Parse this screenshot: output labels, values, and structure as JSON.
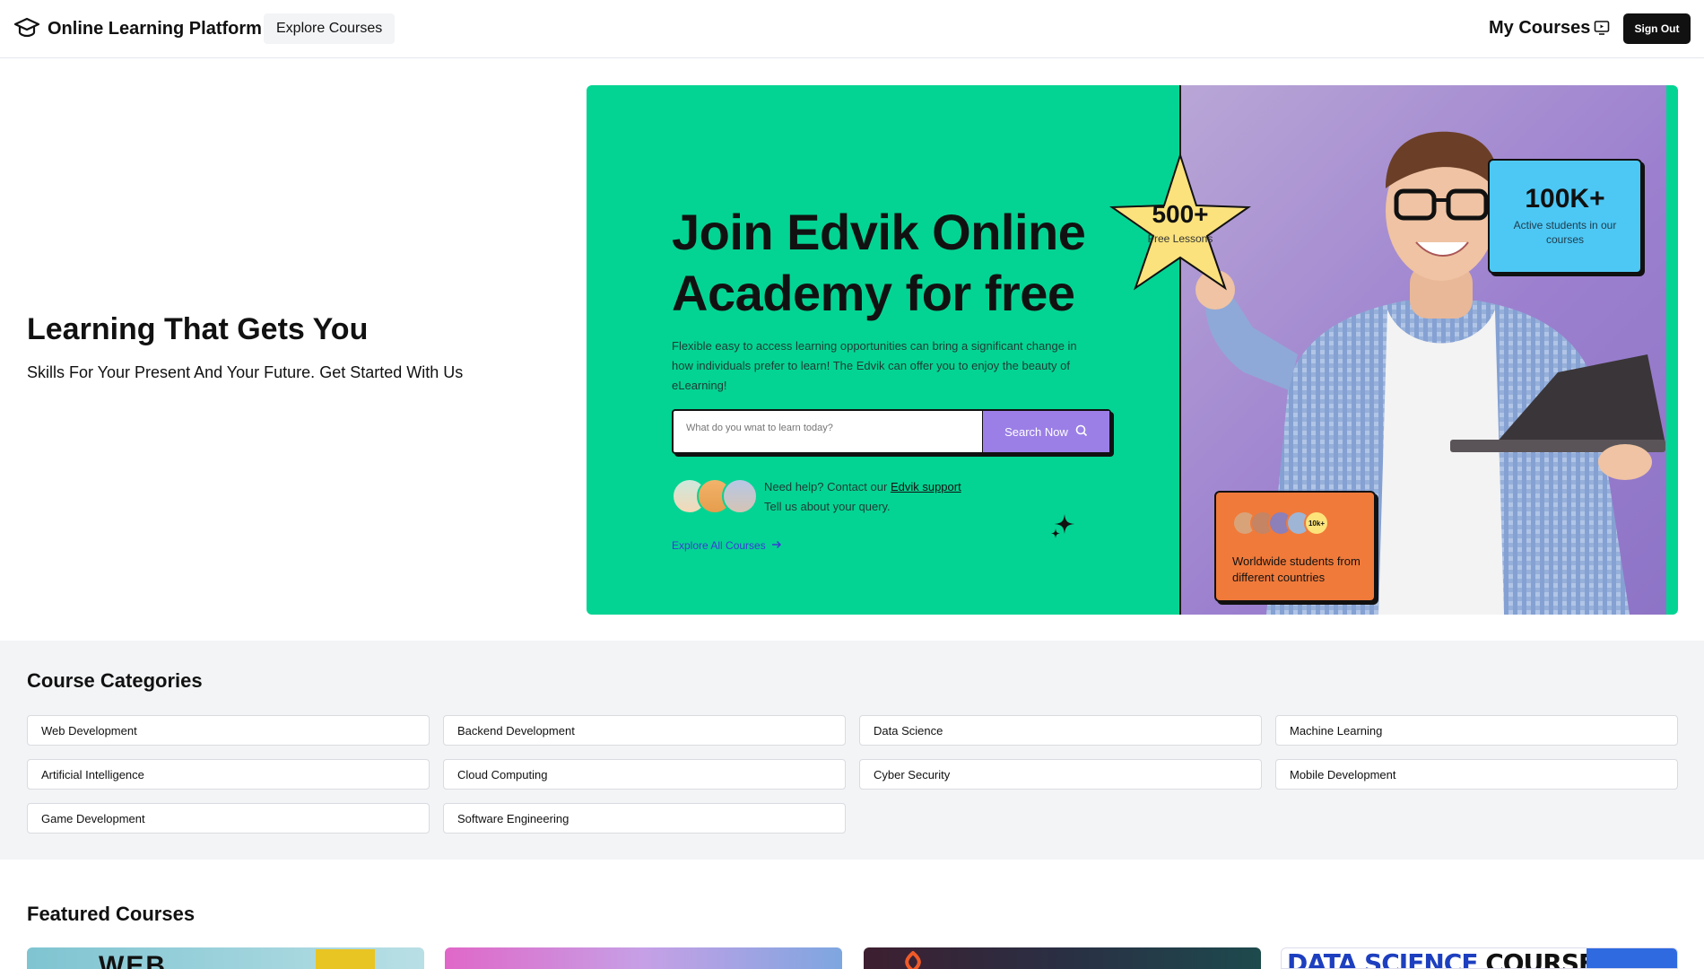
{
  "nav": {
    "brand": "Online Learning Platform",
    "explore": "Explore Courses",
    "my_courses": "My Courses",
    "sign_out": "Sign Out"
  },
  "hero": {
    "title": "Learning That Gets You",
    "subtitle": "Skills For Your Present And Your Future. Get Started With Us"
  },
  "banner": {
    "title_line1": "Join Edvik Online",
    "title_line2": "Academy for free",
    "description": "Flexible easy to access learning opportunities can bring a significant change in how individuals prefer to learn! The Edvik can offer you to enjoy the beauty of eLearning!",
    "search_placeholder": "What do you wnat to learn today?",
    "search_button": "Search Now",
    "help_prefix": "Need help? Contact our",
    "help_link": "Edvik support",
    "help_line2": "Tell us about your query.",
    "explore_all": "Explore All Courses",
    "star_number": "500+",
    "star_label": "Free Lessons",
    "stat_number": "100K+",
    "stat_label": "Active students in our courses",
    "world_count": "10k+",
    "world_label": "Worldwide students from different countries"
  },
  "categories": {
    "title": "Course Categories",
    "items": [
      "Web Development",
      "Backend Development",
      "Data Science",
      "Machine Learning",
      "Artificial Intelligence",
      "Cloud Computing",
      "Cyber Security",
      "Mobile Development",
      "Game Development",
      "Software Engineering"
    ]
  },
  "featured": {
    "title": "Featured Courses",
    "card1_text": "WEB",
    "card4_text_a": "DATA SCIENCE",
    "card4_text_b": "COURSES"
  }
}
